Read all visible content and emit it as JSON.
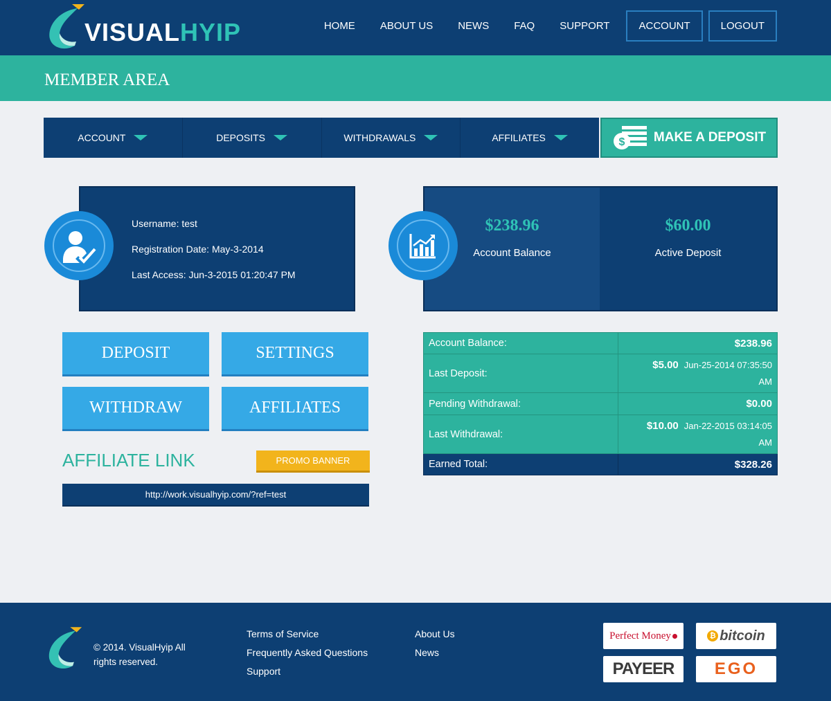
{
  "header": {
    "logo_main": "VISUAL",
    "logo_accent": "HYIP",
    "nav": {
      "home": "HOME",
      "about": "ABOUT US",
      "news": "NEWS",
      "faq": "FAQ",
      "support": "SUPPORT",
      "account": "ACCOUNT",
      "logout": "LOGOUT"
    }
  },
  "page_title": "MEMBER AREA",
  "submenu": {
    "account": "ACCOUNT",
    "deposits": "DEPOSITS",
    "withdrawals": "WITHDRAWALS",
    "affiliates": "AFFILIATES",
    "make_deposit": "MAKE A DEPOSIT"
  },
  "user": {
    "username": "Username: test",
    "registration": "Registration Date: May-3-2014",
    "last_access": "Last Access: Jun-3-2015 01:20:47 PM"
  },
  "balances": {
    "account_balance_amount": "$238.96",
    "account_balance_label": "Account Balance",
    "active_deposit_amount": "$60.00",
    "active_deposit_label": "Active Deposit"
  },
  "actions": {
    "deposit": "DEPOSIT",
    "settings": "SETTINGS",
    "withdraw": "WITHDRAW",
    "affiliates": "AFFILIATES"
  },
  "affiliate": {
    "title": "AFFILIATE LINK",
    "promo_banner": "PROMO BANNER",
    "link": "http://work.visualhyip.com/?ref=test"
  },
  "summary": {
    "account_balance_label": "Account Balance:",
    "account_balance_value": "$238.96",
    "last_deposit_label": "Last Deposit:",
    "last_deposit_amount": "$5.00",
    "last_deposit_date": "Jun-25-2014 07:35:50",
    "last_deposit_ampm": "AM",
    "pending_withdrawal_label": "Pending Withdrawal:",
    "pending_withdrawal_value": "$0.00",
    "last_withdrawal_label": "Last Withdrawal:",
    "last_withdrawal_amount": "$10.00",
    "last_withdrawal_date": "Jan-22-2015 03:14:05",
    "last_withdrawal_ampm": "AM",
    "earned_total_label": "Earned Total:",
    "earned_total_value": "$328.26"
  },
  "footer": {
    "copyright": "© 2014. VisualHyip All rights reserved.",
    "links": {
      "terms": "Terms of Service",
      "faq": "Frequently Asked Questions",
      "support": "Support",
      "about": "About Us",
      "news": "News"
    },
    "payments": {
      "perfect_money": "Perfect Money",
      "bitcoin": "bitcoin",
      "payeer": "PAYEER",
      "egopay": "EGO"
    }
  },
  "colors": {
    "navy": "#0d3f73",
    "teal": "#2db39e",
    "sky": "#35a9e6",
    "orange": "#f2b41c"
  }
}
